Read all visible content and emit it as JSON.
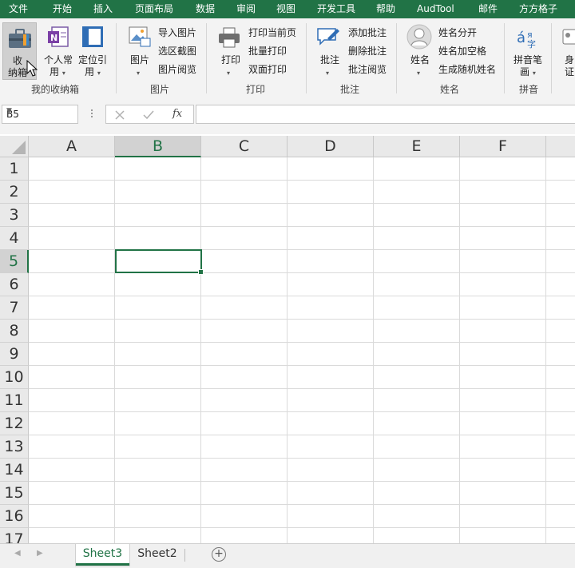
{
  "menu": [
    "文件",
    "开始",
    "插入",
    "页面布局",
    "数据",
    "审阅",
    "视图",
    "开发工具",
    "帮助",
    "AudTool",
    "邮件",
    "方方格子"
  ],
  "ribbon": {
    "box": {
      "line1": "收",
      "line2": "纳箱",
      "group": "我的收纳箱"
    },
    "personal": {
      "line1": "个人常",
      "line2": "用"
    },
    "locate": {
      "line1": "定位引",
      "line2": "用"
    },
    "picture": {
      "label": "图片",
      "items": [
        "导入图片",
        "选区截图",
        "图片阅览"
      ],
      "group": "图片"
    },
    "print": {
      "label": "打印",
      "items": [
        "打印当前页",
        "批量打印",
        "双面打印"
      ],
      "group": "打印"
    },
    "comment": {
      "label": "批注",
      "items": [
        "添加批注",
        "删除批注",
        "批注阅览"
      ],
      "group": "批注"
    },
    "name": {
      "label": "姓名",
      "items": [
        "姓名分开",
        "姓名加空格",
        "生成随机姓名"
      ],
      "group": "姓名"
    },
    "pinyin": {
      "line1": "拼音笔",
      "line2": "画",
      "group": "拼音"
    },
    "idcard": {
      "line1": "身",
      "line2": "证"
    }
  },
  "formula": {
    "namebox": "B5",
    "fx": "fx",
    "value": ""
  },
  "grid": {
    "columns": [
      "A",
      "B",
      "C",
      "D",
      "E",
      "F"
    ],
    "rows": [
      "1",
      "2",
      "3",
      "4",
      "5",
      "6",
      "7",
      "8",
      "9",
      "10",
      "11",
      "12",
      "13",
      "14",
      "15",
      "16",
      "17"
    ],
    "selected_col": "B",
    "selected_row": "5"
  },
  "sheets": {
    "tabs": [
      "Sheet3",
      "Sheet2"
    ],
    "active": "Sheet3",
    "add": "⊕"
  },
  "colors": {
    "accent": "#217346"
  }
}
